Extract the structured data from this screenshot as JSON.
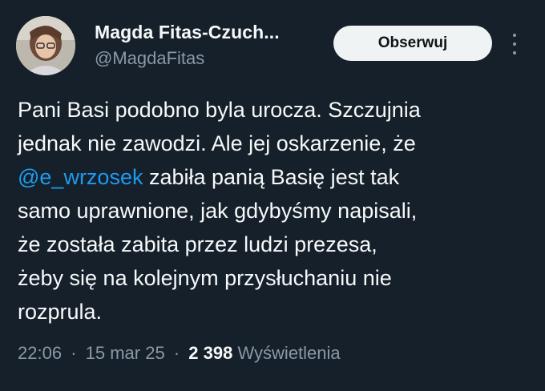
{
  "author": {
    "display_name": "Magda Fitas-Czuch...",
    "handle": "@MagdaFitas"
  },
  "actions": {
    "follow_label": "Obserwuj",
    "more_icon": "more-vertical-icon"
  },
  "tweet": {
    "line1": "Pani Basi podobno byla urocza. Szczujnia",
    "line2": "jednak nie zawodzi. Ale jej oskarzenie, że",
    "mention": "@e_wrzosek",
    "line3_rest": " zabiła panią Basię jest tak",
    "line4": "samo uprawnione, jak gdybyśmy napisali,",
    "line5": "że została zabita przez ludzi prezesa,",
    "line6": "żeby się na kolejnym przysłuchaniu nie",
    "line7": "rozprula."
  },
  "meta": {
    "time": "22:06",
    "date": "15 mar 25",
    "separator": "·",
    "views_count": "2 398",
    "views_label": "Wyświetlenia"
  },
  "colors": {
    "background": "#15202b",
    "text": "#f7f9f9",
    "secondary": "#8b98a5",
    "link": "#1d9bf0",
    "button_bg": "#eff3f4"
  }
}
